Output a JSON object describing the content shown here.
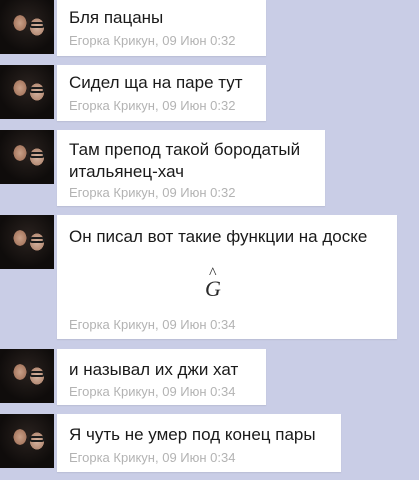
{
  "messages": [
    {
      "text": "Бля пацаны",
      "author": "Егорка Крикун",
      "time": "09 Июн 0:32"
    },
    {
      "text": "Сидел ща на паре тут",
      "author": "Егорка Крикун",
      "time": "09 Июн 0:32"
    },
    {
      "text_line1": "Там препод такой бородатый",
      "text_line2": "итальянец-хач",
      "author": "Егорка Крикун",
      "time": "09 Июн 0:32"
    },
    {
      "text": "Он писал вот такие функции на доске",
      "formula": "G",
      "formula_hat": "^",
      "author": "Егорка Крикун",
      "time": "09 Июн 0:34"
    },
    {
      "text": "и называл их джи хат",
      "author": "Егорка Крикун",
      "time": "09 Июн 0:34"
    },
    {
      "text": "Я чуть не умер под конец пары",
      "author": "Егорка Крикун",
      "time": "09 Июн 0:34"
    }
  ],
  "meta_separator": ", "
}
